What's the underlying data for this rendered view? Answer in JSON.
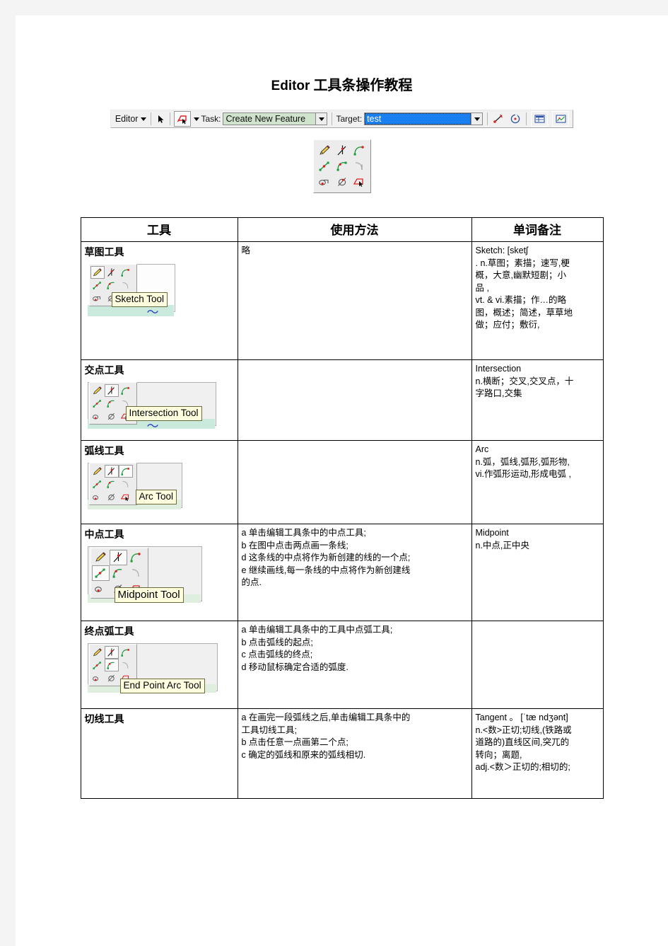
{
  "document": {
    "title_latin": "Editor",
    "title_cn": " 工具条操作教程"
  },
  "toolbar": {
    "editor_menu_label": "Editor",
    "arrow_icon": "select-arrow-icon",
    "edit_task_icon": "edit-tool-icon",
    "task_label": "Task:",
    "task_value": "Create New Feature",
    "target_label": "Target:",
    "target_value": "test",
    "right_icons": [
      "split-icon",
      "rotate-icon",
      "attributes-icon",
      "sketch-properties-icon"
    ]
  },
  "palette": {
    "name": "editor-sketch-tool-palette",
    "icons": [
      "sketch-pencil-icon",
      "intersection-icon",
      "arc-icon",
      "midpoint-icon",
      "endpoint-arc-icon",
      "tangent-icon",
      "trace-icon",
      "direction-icon",
      "distance-azimuth-icon"
    ]
  },
  "table": {
    "headers": [
      "工具",
      "使用方法",
      "单词备注"
    ],
    "rows": [
      {
        "tool_name": "草图工具",
        "tooltip": "Sketch Tool",
        "selected_index": 0,
        "usage": [
          "略"
        ],
        "notes": [
          "Sketch: [sketʃ",
          ". n.草图；素描；速写,梗",
          "概，大意,幽默短剧；小",
          "品 ,",
          "vt. &  vi.素描；作…的略",
          "图，概述；简述，草草地",
          "做；应付；敷衍,"
        ]
      },
      {
        "tool_name": "交点工具",
        "tooltip": "Intersection Tool",
        "selected_index": 1,
        "usage": [],
        "notes": [
          "Intersection",
          "n.横断；交叉,交叉点，十",
          "字路口,交集"
        ]
      },
      {
        "tool_name": "弧线工具",
        "tooltip": "Arc Tool",
        "selected_index": 2,
        "usage": [],
        "notes": [
          "Arc",
          "n.弧，弧线,弧形,弧形物,",
          "vi.作弧形运动,形成电弧 ,"
        ]
      },
      {
        "tool_name": "中点工具",
        "tooltip": "Midpoint Tool",
        "selected_index": 3,
        "usage": [
          "a 单击编辑工具条中的中点工具;",
          "b 在图中点击两点画一条线;",
          "d 这条线的中点将作为新创建的线的一个点;",
          "e 继续画线,每一条线的中点将作为新创建线",
          "的点."
        ],
        "notes": [
          "Midpoint",
          "n.中点,正中央"
        ]
      },
      {
        "tool_name": "终点弧工具",
        "tooltip": "End Point Arc Tool",
        "selected_index": 4,
        "usage": [
          "a 单击编辑工具条中的工具中点弧工具;",
          "b 点击弧线的起点;",
          "c 点击弧线的终点;",
          "d 移动鼠标确定合适的弧度."
        ],
        "notes": []
      },
      {
        "tool_name": "切线工具",
        "tooltip": "",
        "selected_index": -1,
        "usage": [
          "a 在画完一段弧线之后,单击编辑工具条中的",
          "工具切线工具;",
          "b 点击任意一点画第二个点;",
          "c 确定的弧线和原来的弧线相切."
        ],
        "notes": [
          "Tangent 。 [ˈtæ ndʒənt]",
          "n.<数>正切;切线,(铁路或",
          "道路的)直线区间,突兀的",
          "转向；离题,",
          "adj.<数＞正切的;相切的;"
        ]
      }
    ]
  },
  "colors": {
    "page_margin": "#f4f4f4",
    "task_field": "#cfe3cd",
    "target_field": "#1a7ff0",
    "tooltip_bg": "#ffffdf",
    "green_band": "#c9eadd"
  }
}
